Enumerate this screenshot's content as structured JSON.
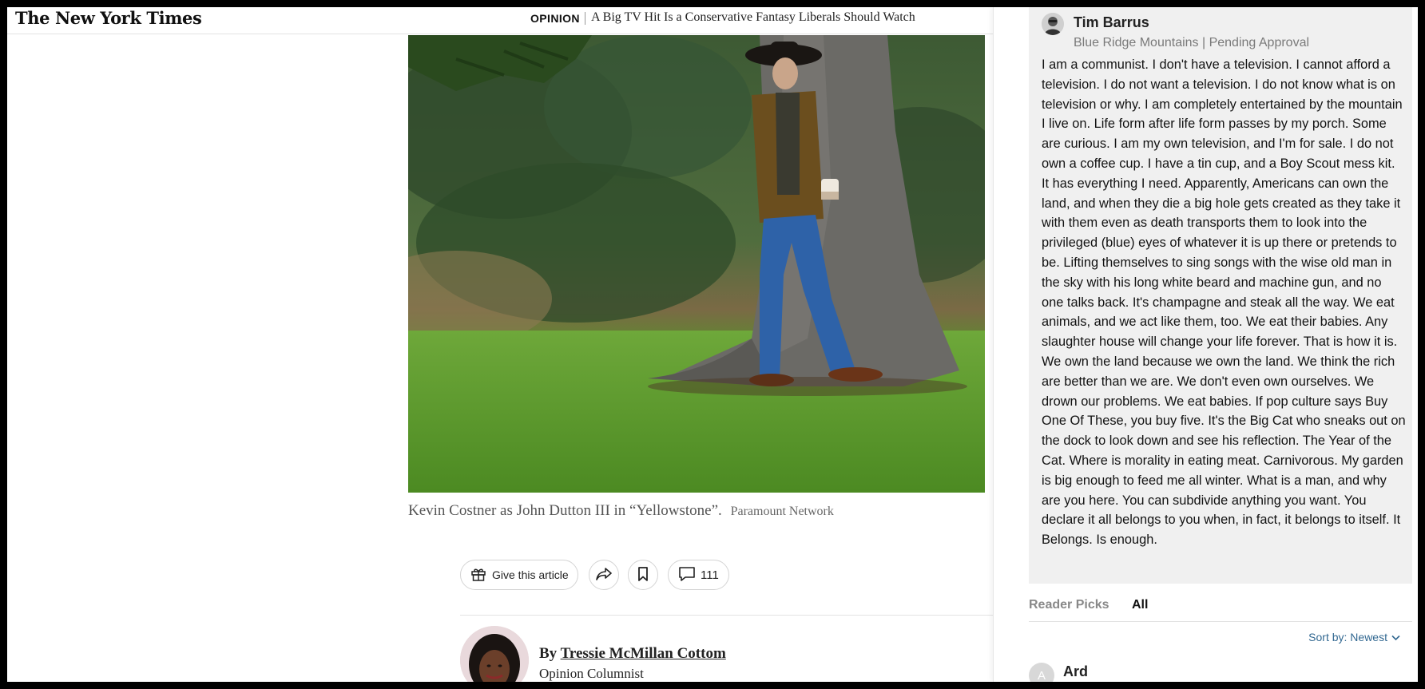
{
  "header": {
    "logo": "The New York Times",
    "section": "OPINION",
    "headline": "A Big TV Hit Is a Conservative Fantasy Liberals Should Watch"
  },
  "photo": {
    "caption": "Kevin Costner as John Dutton III in “Yellowstone”.",
    "credit": "Paramount Network"
  },
  "actions": {
    "gift_label": "Give this article",
    "comment_count": "111"
  },
  "byline": {
    "prefix": "By ",
    "author": "Tressie McMillan Cottom",
    "role": "Opinion Columnist"
  },
  "comments": {
    "featured": {
      "author": "Tim Barrus",
      "meta": "Blue Ridge Mountains | Pending Approval",
      "body": "I am a communist. I don't have a television. I cannot afford a television. I do not want a television. I do not know what is on television or why. I am completely entertained by the mountain I live on. Life form after life form passes by my porch. Some are curious. I am my own television, and I'm for sale. I do not own a coffee cup. I have a tin cup, and a Boy Scout mess kit. It has everything I need. Apparently, Americans can own the land, and when they die a big hole gets created as they take it with them even as death transports them to look into the privileged (blue) eyes of whatever it is up there or pretends to be. Lifting themselves to sing songs with the wise old man in the sky with his long white beard and machine gun, and no one talks back. It's champagne and steak all the way. We eat animals, and we act like them, too. We eat their babies. Any slaughter house will change your life forever. That is how it is. We own the land because we own the land. We think the rich are better than we are. We don't even own ourselves. We drown our problems. We eat babies. If pop culture says Buy One Of These, you buy five. It's the Big Cat who sneaks out on the dock to look down and see his reflection. The Year of the Cat. Where is morality in eating meat. Carnivorous. My garden is big enough to feed me all winter. What is a man, and why are you here. You can subdivide anything you want. You declare it all belongs to you when, in fact, it belongs to itself. It Belongs. Is enough."
    },
    "tabs": [
      "Reader Picks",
      "All"
    ],
    "active_tab": "All",
    "sort_label": "Sort by: Newest",
    "next": {
      "initial": "A",
      "author": "Ard"
    }
  },
  "colors": {
    "link_blue": "#326891",
    "panel_card": "#f0f0f0",
    "meta_gray": "#7a7a7a"
  },
  "icons": [
    "gift-icon",
    "share-icon",
    "bookmark-icon",
    "comment-icon",
    "chevron-down-icon"
  ]
}
